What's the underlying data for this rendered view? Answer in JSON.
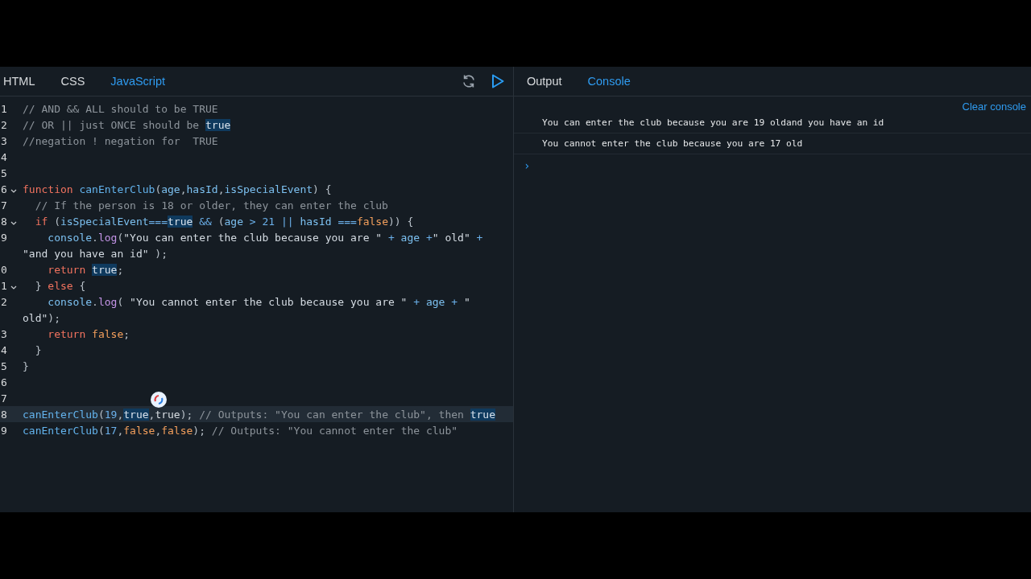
{
  "editor": {
    "tabs": [
      {
        "label": "HTML",
        "selected": false
      },
      {
        "label": "CSS",
        "selected": false
      },
      {
        "label": "JavaScript",
        "selected": true
      }
    ],
    "lines": [
      {
        "number": "1",
        "foldable": false,
        "current": false,
        "tokens": [
          {
            "kind": "c",
            "text": "// AND && ALL should to be TRUE"
          }
        ]
      },
      {
        "number": "2",
        "foldable": false,
        "current": false,
        "tokens": [
          {
            "kind": "c",
            "text": "// OR || just ONCE should be "
          },
          {
            "kind": "m",
            "text": "true"
          }
        ]
      },
      {
        "number": "3",
        "foldable": false,
        "current": false,
        "tokens": [
          {
            "kind": "c",
            "text": "//negation ! negation for  TRUE"
          }
        ]
      },
      {
        "number": "4",
        "foldable": false,
        "current": false
      },
      {
        "number": "5",
        "foldable": false,
        "current": false
      },
      {
        "number": "6",
        "foldable": true,
        "current": false,
        "tokens": [
          {
            "kind": "k",
            "text": "function "
          },
          {
            "kind": "f",
            "text": "canEnterClub"
          },
          {
            "kind": "x",
            "text": "("
          },
          {
            "kind": "p",
            "text": "age"
          },
          {
            "kind": "x",
            "text": ","
          },
          {
            "kind": "p",
            "text": "hasId"
          },
          {
            "kind": "x",
            "text": ","
          },
          {
            "kind": "p",
            "text": "isSpecialEvent"
          },
          {
            "kind": "x",
            "text": ") {"
          }
        ]
      },
      {
        "number": "7",
        "foldable": false,
        "current": false,
        "tokens": [
          {
            "kind": "c",
            "text": "  // If the person is 18 or older, they can enter the club"
          }
        ]
      },
      {
        "number": "8",
        "foldable": true,
        "current": false,
        "tokens": [
          {
            "kind": "k",
            "text": "  if"
          },
          {
            "kind": "x",
            "text": " ("
          },
          {
            "kind": "p",
            "text": "isSpecialEvent"
          },
          {
            "kind": "o",
            "text": "==="
          },
          {
            "kind": "m",
            "text": "true"
          },
          {
            "kind": "o",
            "text": " &&"
          },
          {
            "kind": "x",
            "text": " ("
          },
          {
            "kind": "p",
            "text": "age"
          },
          {
            "kind": "o",
            "text": " >"
          },
          {
            "kind": "n",
            "text": " 21"
          },
          {
            "kind": "o",
            "text": " ||"
          },
          {
            "kind": "p",
            "text": " hasId"
          },
          {
            "kind": "o",
            "text": " ==="
          },
          {
            "kind": "b",
            "text": "false"
          },
          {
            "kind": "x",
            "text": ")) {"
          }
        ]
      },
      {
        "number": "9",
        "foldable": false,
        "current": false,
        "tokens": [
          {
            "kind": "p",
            "text": "    console"
          },
          {
            "kind": "x",
            "text": "."
          },
          {
            "kind": "g",
            "text": "log"
          },
          {
            "kind": "x",
            "text": "("
          },
          {
            "kind": "s",
            "text": "\"You can enter the club because you are \""
          },
          {
            "kind": "o",
            "text": " +"
          },
          {
            "kind": "p",
            "text": " age"
          },
          {
            "kind": "o",
            "text": " +"
          },
          {
            "kind": "s",
            "text": "\" old\""
          },
          {
            "kind": "o",
            "text": " +"
          }
        ],
        "wrap": [
          {
            "kind": "s",
            "text": "\"and you have an id\""
          },
          {
            "kind": "x",
            "text": " );"
          }
        ]
      },
      {
        "number": "0",
        "foldable": false,
        "current": false,
        "tokens": [
          {
            "kind": "k",
            "text": "    return "
          },
          {
            "kind": "m",
            "text": "true"
          },
          {
            "kind": "x",
            "text": ";"
          }
        ]
      },
      {
        "number": "1",
        "foldable": true,
        "current": false,
        "tokens": [
          {
            "kind": "x",
            "text": "  } "
          },
          {
            "kind": "k",
            "text": "else"
          },
          {
            "kind": "x",
            "text": " {"
          }
        ]
      },
      {
        "number": "2",
        "foldable": false,
        "current": false,
        "tokens": [
          {
            "kind": "p",
            "text": "    console"
          },
          {
            "kind": "x",
            "text": "."
          },
          {
            "kind": "g",
            "text": "log"
          },
          {
            "kind": "x",
            "text": "( "
          },
          {
            "kind": "s",
            "text": "\"You cannot enter the club because you are \""
          },
          {
            "kind": "o",
            "text": " +"
          },
          {
            "kind": "p",
            "text": " age"
          },
          {
            "kind": "o",
            "text": " +"
          },
          {
            "kind": "s",
            "text": " \""
          }
        ],
        "wrap": [
          {
            "kind": "s",
            "text": "old\""
          },
          {
            "kind": "x",
            "text": ");"
          }
        ]
      },
      {
        "number": "3",
        "foldable": false,
        "current": false,
        "tokens": [
          {
            "kind": "k",
            "text": "    return "
          },
          {
            "kind": "b",
            "text": "false"
          },
          {
            "kind": "x",
            "text": ";"
          }
        ]
      },
      {
        "number": "4",
        "foldable": false,
        "current": false,
        "tokens": [
          {
            "kind": "x",
            "text": "  }"
          }
        ]
      },
      {
        "number": "5",
        "foldable": false,
        "current": false,
        "tokens": [
          {
            "kind": "x",
            "text": "}"
          }
        ]
      },
      {
        "number": "6",
        "foldable": false,
        "current": false
      },
      {
        "number": "7",
        "foldable": false,
        "current": false
      },
      {
        "number": "8",
        "foldable": false,
        "current": true,
        "tokens": [
          {
            "kind": "f",
            "text": "canEnterClub"
          },
          {
            "kind": "x",
            "text": "("
          },
          {
            "kind": "n",
            "text": "19"
          },
          {
            "kind": "x",
            "text": ","
          },
          {
            "kind": "m",
            "text": "true"
          },
          {
            "kind": "x",
            "text": ","
          },
          {
            "kind": "t",
            "text": "true"
          },
          {
            "kind": "x",
            "text": ");"
          },
          {
            "kind": "c",
            "text": " // Outputs: \"You can enter the club\", then "
          },
          {
            "kind": "m",
            "text": "true"
          }
        ]
      },
      {
        "number": "9",
        "foldable": false,
        "current": false,
        "tokens": [
          {
            "kind": "f",
            "text": "canEnterClub"
          },
          {
            "kind": "x",
            "text": "("
          },
          {
            "kind": "n",
            "text": "17"
          },
          {
            "kind": "x",
            "text": ","
          },
          {
            "kind": "b",
            "text": "false"
          },
          {
            "kind": "x",
            "text": ","
          },
          {
            "kind": "b",
            "text": "false"
          },
          {
            "kind": "x",
            "text": ");"
          },
          {
            "kind": "c",
            "text": " // Outputs: \"You cannot enter the club\""
          }
        ]
      }
    ]
  },
  "preview": {
    "tabs": [
      {
        "label": "Output",
        "selected": false
      },
      {
        "label": "Console",
        "selected": true
      }
    ],
    "clear_button": "Clear console",
    "messages": [
      "You can enter the club because you are 19 oldand you have an id",
      "You cannot enter the club because you are 17 old"
    ],
    "prompt": "›"
  }
}
